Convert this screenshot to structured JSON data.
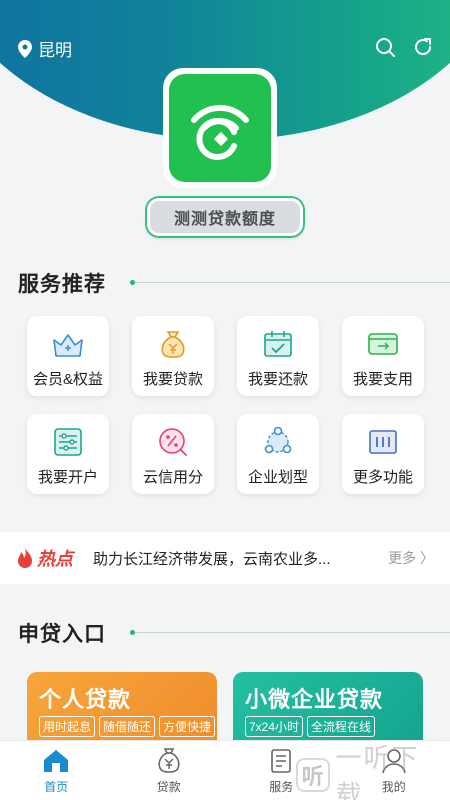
{
  "header": {
    "location": "昆明",
    "search_icon": "search-icon",
    "refresh_icon": "refresh-icon"
  },
  "quota_button": "测测贷款额度",
  "services": {
    "title": "服务推荐",
    "items": [
      {
        "label": "会员&权益",
        "icon": "crown-icon"
      },
      {
        "label": "我要贷款",
        "icon": "money-bag-icon"
      },
      {
        "label": "我要还款",
        "icon": "calendar-check-icon"
      },
      {
        "label": "我要支用",
        "icon": "card-transfer-icon"
      },
      {
        "label": "我要开户",
        "icon": "sliders-icon"
      },
      {
        "label": "云信用分",
        "icon": "percent-icon"
      },
      {
        "label": "企业划型",
        "icon": "network-icon"
      },
      {
        "label": "更多功能",
        "icon": "more-grid-icon"
      }
    ]
  },
  "hot": {
    "tag": "热点",
    "news": "助力长江经济带发展，云南农业多...",
    "more": "更多"
  },
  "loan_entry": {
    "title": "申贷入口",
    "cards": [
      {
        "title": "个人贷款",
        "chips": [
          "用时起息",
          "随借随还",
          "方便快捷"
        ]
      },
      {
        "title": "小微企业贷款",
        "chips": [
          "7x24小时",
          "全流程在线"
        ]
      }
    ]
  },
  "nav": {
    "items": [
      {
        "label": "首页",
        "icon": "home-icon",
        "active": true
      },
      {
        "label": "贷款",
        "icon": "loan-bag-icon",
        "active": false
      },
      {
        "label": "服务",
        "icon": "service-icon",
        "active": false
      },
      {
        "label": "我的",
        "icon": "user-icon",
        "active": false
      }
    ]
  },
  "watermark": {
    "icon_text": "听",
    "text": "一听下载"
  },
  "colors": {
    "brand_green": "#22c04f",
    "accent_teal": "#24b56c",
    "active_blue": "#1a8bd0",
    "hot_red": "#e8413b",
    "card_orange": "#f5a030",
    "card_teal": "#1fb99e"
  }
}
